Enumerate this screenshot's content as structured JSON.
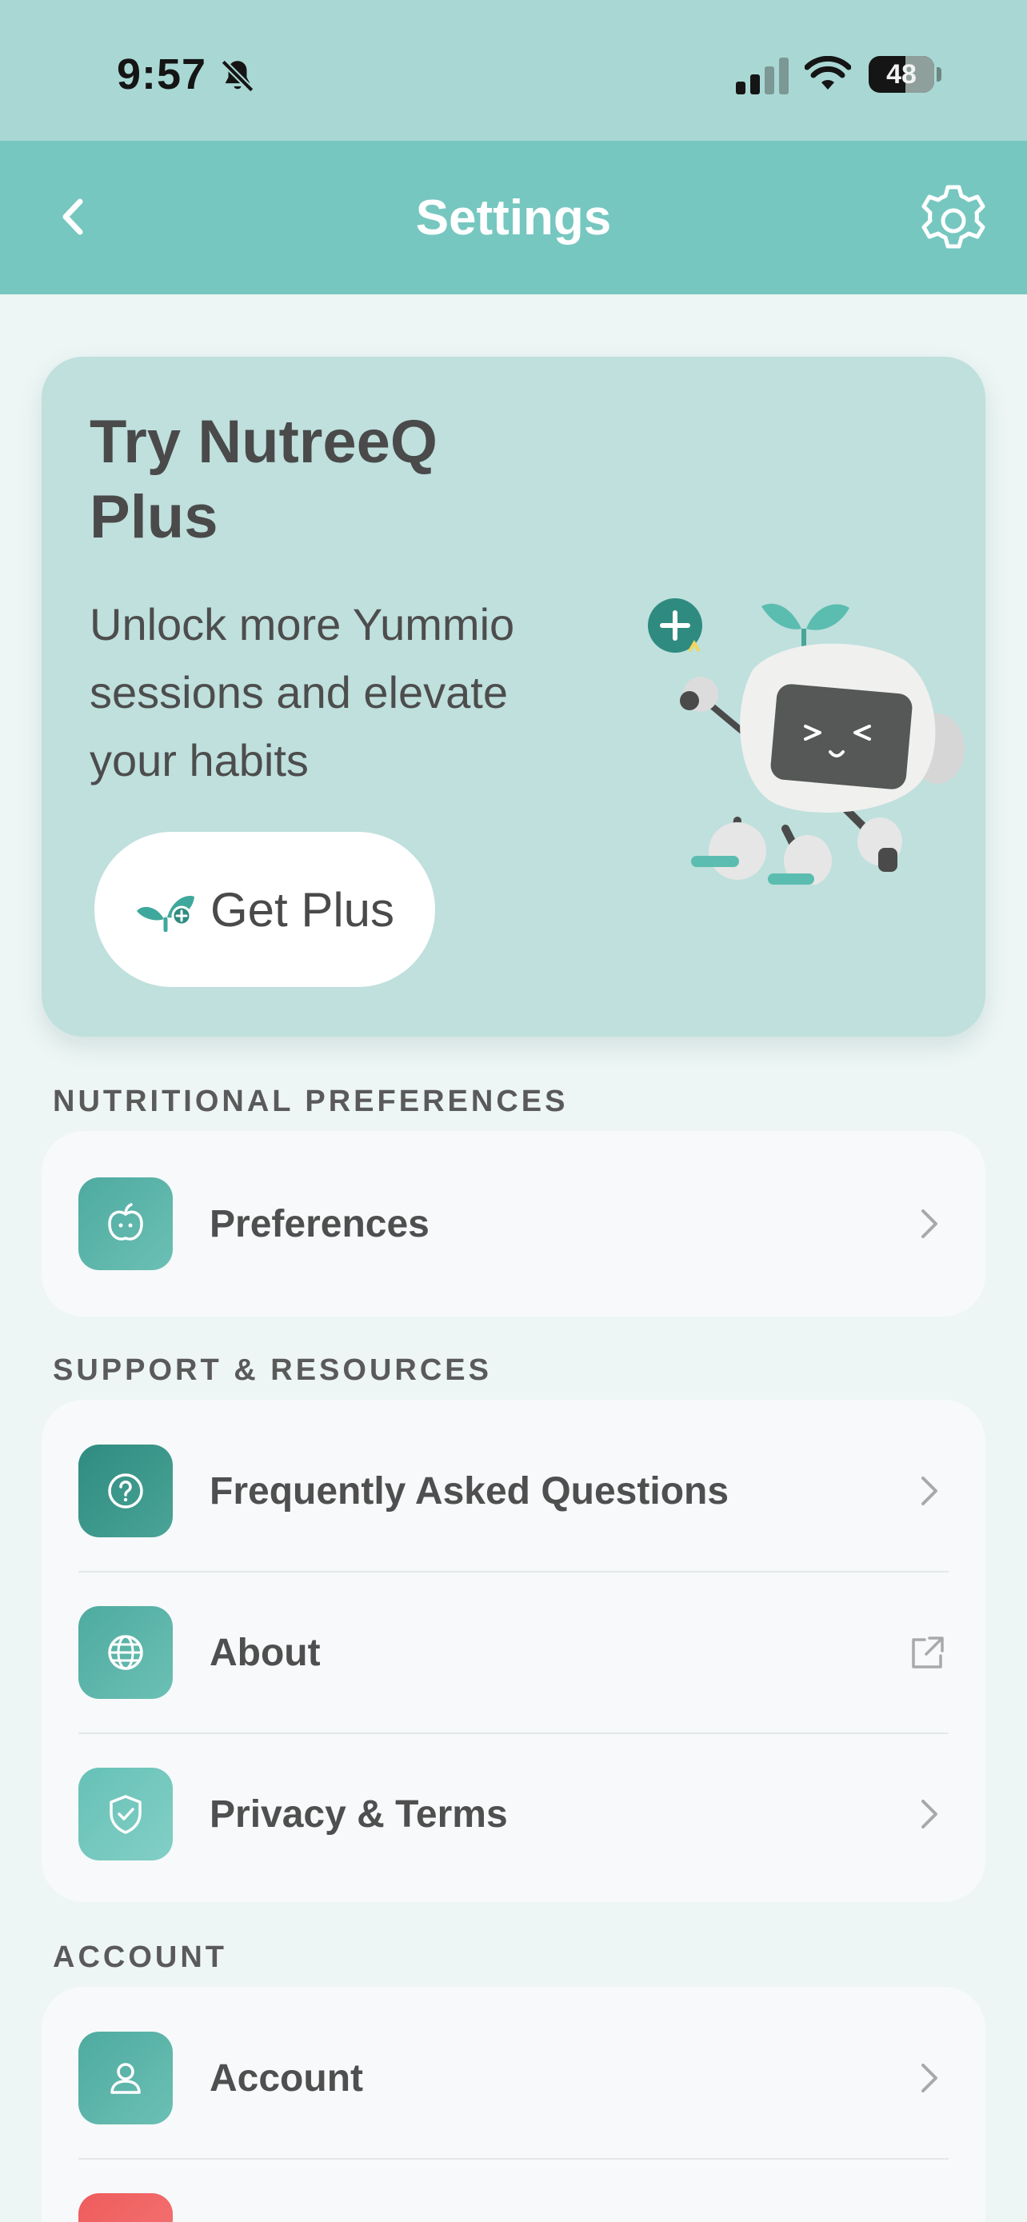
{
  "status_bar": {
    "time": "9:57",
    "battery": "48",
    "icons": [
      "bell-off-icon",
      "cellular-signal-icon",
      "wifi-icon",
      "battery-icon"
    ]
  },
  "nav": {
    "title": "Settings",
    "back_icon": "chevron-left-icon",
    "settings_icon": "gear-icon"
  },
  "promo": {
    "title": "Try NutreeQ Plus",
    "description": "Unlock more Yummio sessions and elevate your habits",
    "button_label": "Get Plus",
    "button_icon": "sprout-plus-icon",
    "illustration": "robot-mascot"
  },
  "sections": {
    "nutrition": {
      "heading": "NUTRITIONAL PREFERENCES",
      "items": [
        {
          "label": "Preferences",
          "icon": "apple-icon",
          "trailing": "chevron-right-icon"
        }
      ]
    },
    "support": {
      "heading": "SUPPORT & RESOURCES",
      "items": [
        {
          "label": "Frequently Asked Questions",
          "icon": "question-circle-icon",
          "trailing": "chevron-right-icon"
        },
        {
          "label": "About",
          "icon": "globe-icon",
          "trailing": "external-link-icon"
        },
        {
          "label": "Privacy & Terms",
          "icon": "shield-check-icon",
          "trailing": "chevron-right-icon"
        }
      ]
    },
    "account": {
      "heading": "ACCOUNT",
      "items": [
        {
          "label": "Account",
          "icon": "user-icon",
          "trailing": "chevron-right-icon"
        }
      ]
    }
  },
  "colors": {
    "status_bar": "#a9d8d4",
    "nav_bar": "#76c7c0",
    "page_bg": "#edf6f5",
    "promo_bg": "#bfe0dd",
    "accent_teal": "#4eaa9f",
    "danger_red": "#ef5c5c"
  }
}
